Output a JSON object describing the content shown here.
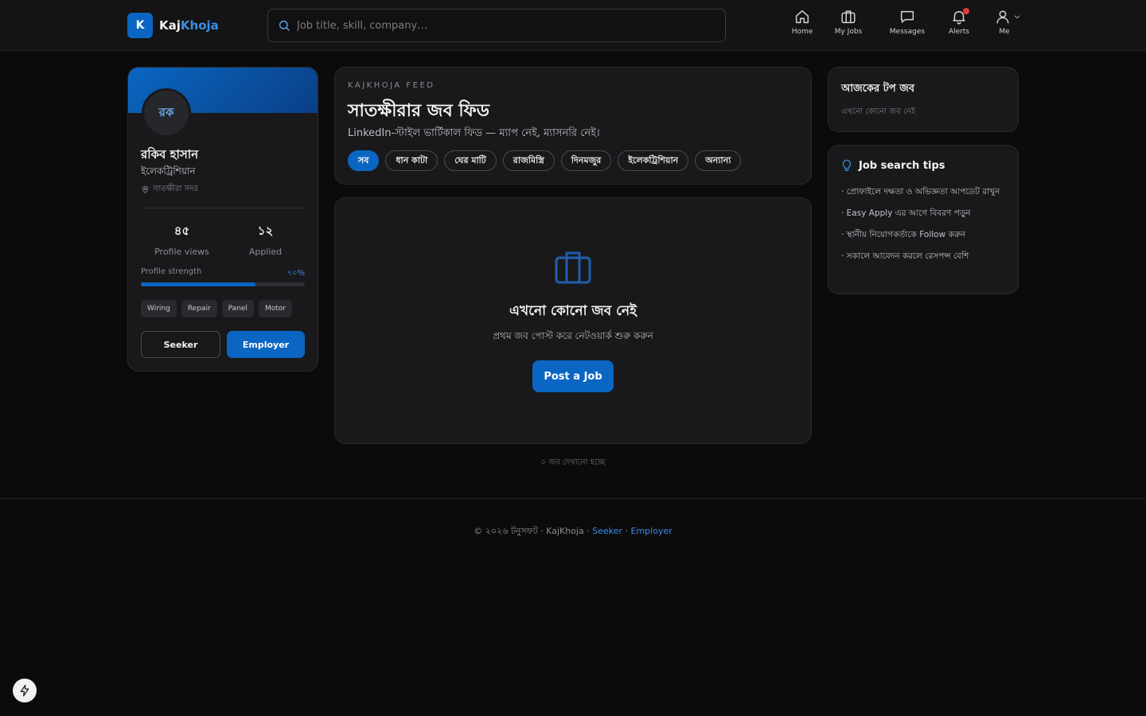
{
  "header": {
    "logo_letter": "K",
    "logo_text_a": "Kaj",
    "logo_text_b": "Khoja",
    "search_placeholder": "Job title, skill, company…",
    "nav": [
      {
        "label": "Home",
        "icon": "home-icon"
      },
      {
        "label": "My Jobs",
        "icon": "briefcase-icon"
      },
      {
        "label": "Messages",
        "icon": "message-icon"
      },
      {
        "label": "Alerts",
        "icon": "bell-icon",
        "has_badge": true
      },
      {
        "label": "Me",
        "icon": "user-icon"
      }
    ]
  },
  "profile": {
    "initials": "রক",
    "name": "রকিব হাসান",
    "role": "ইলেকট্রিশিয়ান",
    "location": "সাতক্ষীরা সদর",
    "stats": [
      {
        "value": "৪৫",
        "label": "Profile views"
      },
      {
        "value": "১২",
        "label": "Applied"
      }
    ],
    "strength_label": "Profile strength",
    "strength_value": "৭০%",
    "strength_fraction": 0.7,
    "skills": [
      "Wiring",
      "Repair",
      "Panel",
      "Motor"
    ],
    "seeker_button": "Seeker",
    "employer_button": "Employer"
  },
  "feed": {
    "eyebrow": "KAJKHOJA FEED",
    "title": "সাতক্ষীরার জব ফিড",
    "subtitle": "LinkedIn-স্টাইল ভার্টিকাল ফিড — ম্যাপ নেই, ম্যাসনরি নেই।",
    "chips": [
      {
        "label": "সব",
        "active": true
      },
      {
        "label": "ধান কাটা",
        "active": false
      },
      {
        "label": "ঘের মাটি",
        "active": false
      },
      {
        "label": "রাজমিস্ত্রি",
        "active": false
      },
      {
        "label": "দিনমজুর",
        "active": false
      },
      {
        "label": "ইলেকট্রিশিয়ান",
        "active": false
      },
      {
        "label": "অন্যান্য",
        "active": false
      }
    ]
  },
  "empty_state": {
    "title": "এখনো কোনো জব নেই",
    "subtitle": "প্রথম জব পোস্ট করে নেটওয়ার্ক শুরু করুন",
    "button": "Post a Job"
  },
  "count_note": "০ জব দেখানো হচ্ছে",
  "top_jobs": {
    "title": "আজকের টপ জব",
    "empty": "এখনো কোনো জব নেই"
  },
  "tips": {
    "title": "Job search tips",
    "items": [
      "· প্রোফাইলে দক্ষতা ও অভিজ্ঞতা আপডেট রাখুন",
      "· Easy Apply এর আগে বিবরণ পড়ুন",
      "· স্থানীয় নিয়োগকর্তাকে Follow করুন",
      "· সকালে আবেদন করলে রেসপন্স বেশি"
    ]
  },
  "footer": {
    "prefix": "© ২০২৬ টনুসফট · KajKhoja · ",
    "link_seeker": "Seeker",
    "separator": " · ",
    "link_employer": "Employer"
  },
  "colors": {
    "accent": "#0a66c2",
    "accent_light": "#3b8ee8",
    "background": "#0b0b0c",
    "card": "#19191b",
    "alert_dot": "#e23b3b"
  }
}
